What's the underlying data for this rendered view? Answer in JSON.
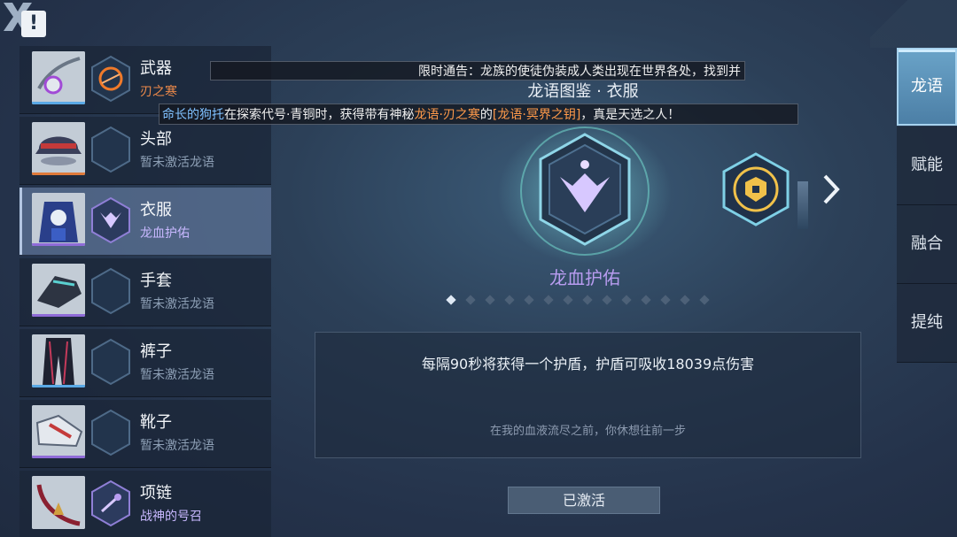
{
  "header": {
    "alert_icon": "exclamation-icon",
    "alert_symbol": "!",
    "close_icon": "close-x-icon"
  },
  "notices": {
    "line1": "限时通告：龙族的使徒伪装成人类出现在世界各处，找到并",
    "line2": {
      "player": "命长的狗托",
      "text1": "在探索代号·青铜时，获得带有神秘",
      "item": "龙语·刃之寒",
      "text2": "的",
      "reward": "[龙语·冥界之钥]",
      "text3": "，真是天选之人！"
    }
  },
  "page_title": "龙语图鉴 · 衣服",
  "equipment": [
    {
      "name": "武器",
      "sub": "刃之寒",
      "icon": "weapon-icon"
    },
    {
      "name": "头部",
      "sub": "暂未激活龙语",
      "icon": "helmet-icon"
    },
    {
      "name": "衣服",
      "sub": "龙血护佑",
      "icon": "clothes-icon"
    },
    {
      "name": "手套",
      "sub": "暂未激活龙语",
      "icon": "gloves-icon"
    },
    {
      "name": "裤子",
      "sub": "暂未激活龙语",
      "icon": "pants-icon"
    },
    {
      "name": "靴子",
      "sub": "暂未激活龙语",
      "icon": "boots-icon"
    },
    {
      "name": "项链",
      "sub": "战神的号召",
      "icon": "necklace-icon"
    }
  ],
  "emblem": {
    "name": "龙血护佑",
    "icon": "dragon-blood-emblem-icon"
  },
  "next_emblem_icon": "dragon-rune-emblem-icon",
  "pager": {
    "total": 14,
    "current": 1
  },
  "description": {
    "main": "每隔90秒将获得一个护盾，护盾可吸收18039点伤害",
    "flavor": "在我的血液流尽之前，你休想往前一步"
  },
  "status_button": "已激活",
  "tabs": [
    {
      "label": "龙语"
    },
    {
      "label": "赋能"
    },
    {
      "label": "融合"
    },
    {
      "label": "提纯"
    }
  ],
  "colors": {
    "accent": "#6aa3c8",
    "emblem_name": "#b89cf0",
    "orange": "#ff9a4a",
    "blue": "#7fc0ff"
  }
}
